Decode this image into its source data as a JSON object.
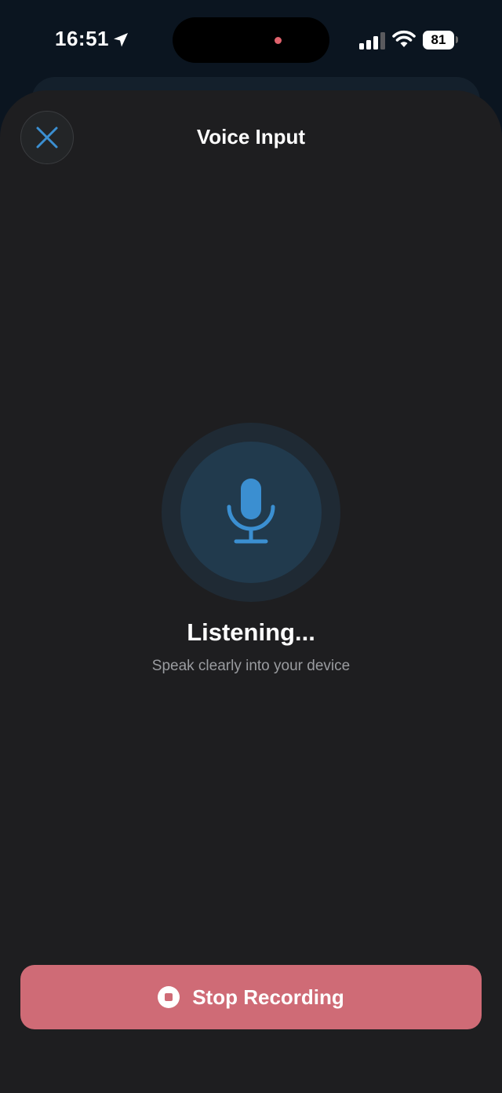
{
  "status_bar": {
    "time": "16:51",
    "battery": "81",
    "icons": [
      "location-arrow-icon",
      "cellular-signal-icon",
      "wifi-icon",
      "battery-icon"
    ]
  },
  "sheet": {
    "title": "Voice Input",
    "close_icon": "close-icon",
    "mic_icon": "microphone-icon",
    "status_title": "Listening...",
    "status_subtitle": "Speak clearly into your device",
    "stop_button": {
      "label": "Stop Recording",
      "icon": "stop-circle-icon"
    }
  },
  "colors": {
    "accent_blue": "#3b8fd1",
    "stop_button": "#cf6b76",
    "sheet_background": "#1e1e20",
    "recording_dot": "#e0636d"
  }
}
